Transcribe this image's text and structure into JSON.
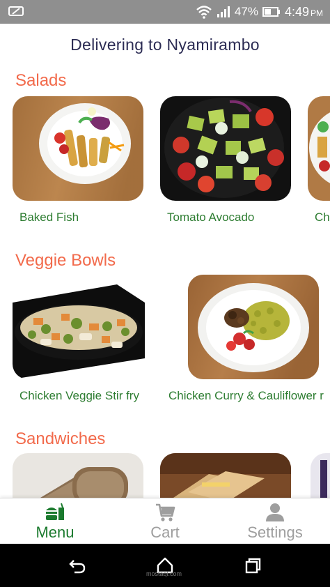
{
  "status_bar": {
    "battery": "47%",
    "time": "4:49",
    "ampm": "PM"
  },
  "header": {
    "title": "Delivering to Nyamirambo"
  },
  "sections": [
    {
      "title": "Salads",
      "items": [
        {
          "name": "Baked Fish"
        },
        {
          "name": "Tomato Avocado"
        },
        {
          "name": "Ch"
        }
      ]
    },
    {
      "title": "Veggie Bowls",
      "items": [
        {
          "name": "Chicken Veggie Stir fry"
        },
        {
          "name": "Chicken Curry & Cauliflower r"
        }
      ]
    },
    {
      "title": "Sandwiches",
      "items": []
    }
  ],
  "tabs": [
    {
      "label": "Menu",
      "icon": "burger-drink-icon",
      "active": true
    },
    {
      "label": "Cart",
      "icon": "cart-icon",
      "active": false
    },
    {
      "label": "Settings",
      "icon": "person-icon",
      "active": false
    }
  ],
  "nav": {
    "watermark": "mostaql.com"
  },
  "colors": {
    "accent_orange": "#f26a4b",
    "item_green": "#2e7d32",
    "active_tab": "#1b7a2e",
    "inactive_tab": "#9e9e9e",
    "header_text": "#2c2c54"
  }
}
